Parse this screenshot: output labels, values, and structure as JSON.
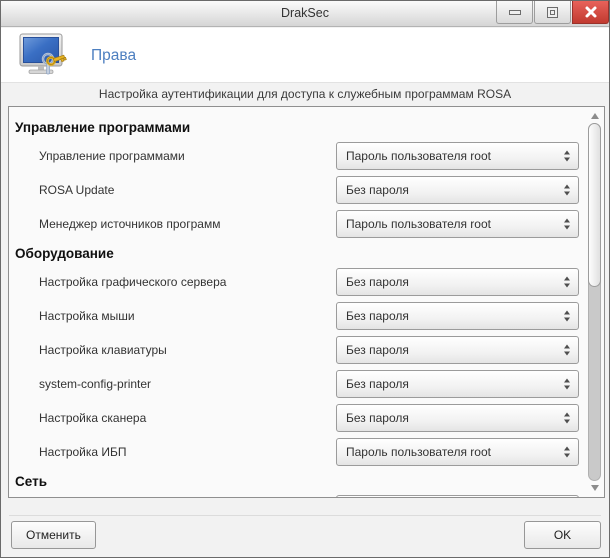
{
  "window": {
    "title": "DrakSec",
    "controls": {
      "minimize": "minimize",
      "maximize": "maximize",
      "close": "close"
    }
  },
  "header": {
    "icon": "monitor-with-keys-icon",
    "title": "Права"
  },
  "subtitle": "Настройка аутентификации для доступа к служебным программам ROSA",
  "sections": [
    {
      "title": "Управление программами",
      "rows": [
        {
          "label": "Управление программами",
          "value": "Пароль пользователя root"
        },
        {
          "label": "ROSA Update",
          "value": "Без пароля"
        },
        {
          "label": "Менеджер источников программ",
          "value": "Пароль пользователя root"
        }
      ]
    },
    {
      "title": "Оборудование",
      "rows": [
        {
          "label": "Настройка графического сервера",
          "value": "Без пароля"
        },
        {
          "label": "Настройка мыши",
          "value": "Без пароля"
        },
        {
          "label": "Настройка клавиатуры",
          "value": "Без пароля"
        },
        {
          "label": "system-config-printer",
          "value": "Без пароля"
        },
        {
          "label": "Настройка сканера",
          "value": "Без пароля"
        },
        {
          "label": "Настройка ИБП",
          "value": "Пароль пользователя root"
        }
      ]
    },
    {
      "title": "Сеть",
      "rows": [],
      "partial_next_row": true
    }
  ],
  "footer": {
    "cancel_label": "Отменить",
    "ok_label": "OK"
  },
  "colors": {
    "accent_blue": "#4d7fc0",
    "close_red": "#c13a30",
    "screen_blue": "#2f64bc",
    "key_gold": "#e7b422"
  }
}
